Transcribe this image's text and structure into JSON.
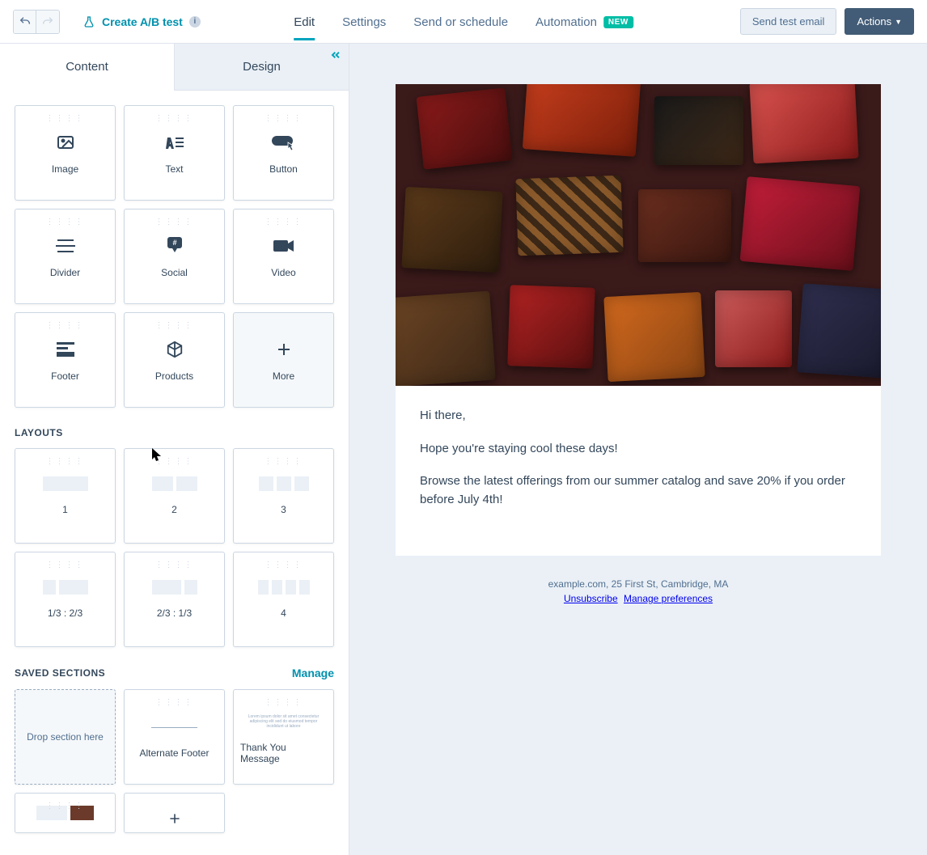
{
  "topbar": {
    "ab_test_label": "Create A/B test",
    "nav": {
      "edit": "Edit",
      "settings": "Settings",
      "send": "Send or schedule",
      "automation": "Automation",
      "new_badge": "NEW"
    },
    "send_test": "Send test email",
    "actions": "Actions"
  },
  "sidebar": {
    "tabs": {
      "content": "Content",
      "design": "Design"
    },
    "blocks": [
      {
        "label": "Image",
        "icon": "image"
      },
      {
        "label": "Text",
        "icon": "text"
      },
      {
        "label": "Button",
        "icon": "button"
      },
      {
        "label": "Divider",
        "icon": "divider"
      },
      {
        "label": "Social",
        "icon": "social"
      },
      {
        "label": "Video",
        "icon": "video"
      },
      {
        "label": "Footer",
        "icon": "footer"
      },
      {
        "label": "Products",
        "icon": "products"
      },
      {
        "label": "More",
        "icon": "more"
      }
    ],
    "layouts_title": "LAYOUTS",
    "layouts": [
      {
        "label": "1"
      },
      {
        "label": "2"
      },
      {
        "label": "3"
      },
      {
        "label": "1/3 : 2/3"
      },
      {
        "label": "2/3 : 1/3"
      },
      {
        "label": "4"
      }
    ],
    "saved_title": "SAVED SECTIONS",
    "manage": "Manage",
    "saved": {
      "drop": "Drop section here",
      "items": [
        {
          "label": "Alternate Footer"
        },
        {
          "label": "Thank You Message"
        }
      ]
    }
  },
  "email": {
    "p1": "Hi there,",
    "p2": "Hope you're staying cool these days!",
    "p3": "Browse the latest offerings from our summer catalog and save 20% if you order before July 4th!",
    "footer_address": "example.com, 25 First St, Cambridge, MA",
    "unsubscribe": "Unsubscribe",
    "preferences": "Manage preferences"
  }
}
